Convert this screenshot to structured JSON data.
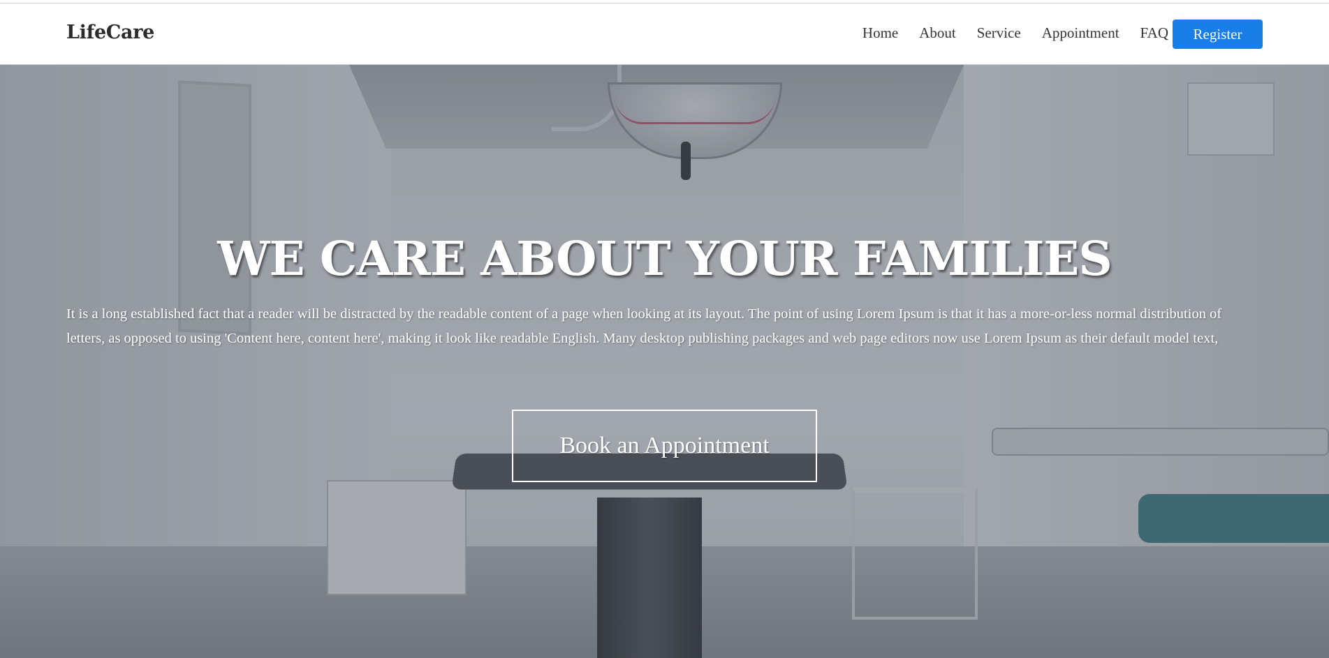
{
  "navbar": {
    "brand": "LifeCare",
    "links": [
      "Home",
      "About",
      "Service",
      "Appointment",
      "FAQ"
    ],
    "register_label": "Register"
  },
  "hero": {
    "title": "WE CARE ABOUT YOUR FAMILIES",
    "description": "It is a long established fact that a reader will be distracted by the readable content of a page when looking at its layout. The point of using Lorem Ipsum is that it has a more-or-less normal distribution of letters, as opposed to using 'Content here, content here', making it look like readable English. Many desktop publishing packages and web page editors now use Lorem Ipsum as their default model text,",
    "cta_label": "Book an Appointment"
  },
  "colors": {
    "accent": "#1a7ee8",
    "nav_text": "#333333",
    "hero_overlay": "#464c58"
  }
}
